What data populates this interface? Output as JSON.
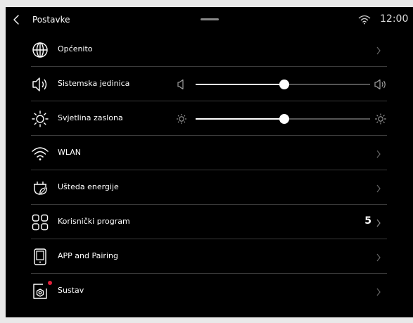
{
  "header": {
    "title": "Postavke",
    "time": "12:00",
    "back_icon": "chevron-left-icon",
    "wifi_icon": "wifi-icon"
  },
  "settings": {
    "general": {
      "label": "Općenito",
      "icon": "globe-icon"
    },
    "volume": {
      "label": "Sistemska jedinica",
      "icon": "speaker-icon",
      "level": 0.51
    },
    "brightness": {
      "label": "Svjetlina zaslona",
      "icon": "sun-icon",
      "level": 0.51
    },
    "wlan": {
      "label": "WLAN",
      "icon": "wifi-icon"
    },
    "energy": {
      "label": "Ušteda energije",
      "icon": "eco-leaf-icon"
    },
    "programs": {
      "label": "Korisnički program",
      "icon": "grid-icon",
      "value": "5"
    },
    "pairing": {
      "label": "APP and Pairing",
      "icon": "tablet-icon"
    },
    "system": {
      "label": "Sustav",
      "icon": "system-gear-icon",
      "badge_color": "#e0203a"
    }
  },
  "colors": {
    "background": "#000000",
    "divider": "#3a3a3a",
    "track": "#555555",
    "accent": "#ffffff"
  }
}
